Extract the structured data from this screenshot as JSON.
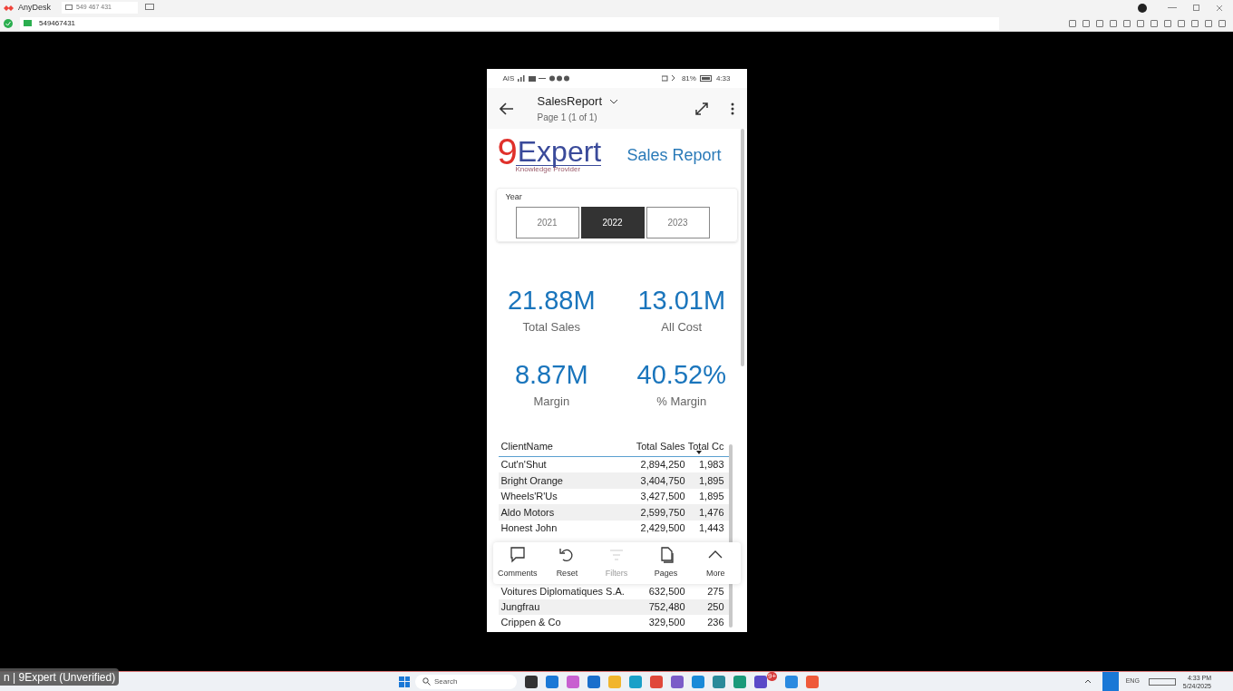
{
  "app": {
    "name": "AnyDesk",
    "tab_label": "549 467 431",
    "address": "549467431"
  },
  "phone": {
    "status_bar": {
      "carrier": "AIS",
      "battery": "81%",
      "time": "4:33"
    },
    "header": {
      "title": "SalesReport",
      "subtitle": "Page 1 (1 of 1)"
    },
    "logo": {
      "digit": "9",
      "word": "Expert",
      "tagline": "Knowledge Provider"
    },
    "report_title": "Sales Report",
    "slicer": {
      "label": "Year",
      "options": [
        {
          "label": "2021",
          "selected": false
        },
        {
          "label": "2022",
          "selected": true
        },
        {
          "label": "2023",
          "selected": false
        }
      ]
    },
    "kpis": [
      {
        "value": "21.88M",
        "label": "Total Sales"
      },
      {
        "value": "13.01M",
        "label": "All Cost"
      },
      {
        "value": "8.87M",
        "label": "Margin"
      },
      {
        "value": "40.52%",
        "label": "% Margin"
      }
    ],
    "table": {
      "columns": [
        {
          "label": "ClientName",
          "sorted": false
        },
        {
          "label": "Total Sales",
          "sorted": false
        },
        {
          "label": "Total Cc",
          "sorted": true
        }
      ],
      "rows": [
        [
          "Cut'n'Shut",
          "2,894,250",
          "1,983"
        ],
        [
          "Bright Orange",
          "3,404,750",
          "1,895"
        ],
        [
          "Wheels'R'Us",
          "3,427,500",
          "1,895"
        ],
        [
          "Aldo Motors",
          "2,599,750",
          "1,476"
        ],
        [
          "Honest John",
          "2,429,500",
          "1,443"
        ],
        null,
        null,
        null,
        [
          "Voitures Diplomatiques S.A.",
          "632,500",
          "275"
        ],
        [
          "Jungfrau",
          "752,480",
          "250"
        ],
        [
          "Crippen & Co",
          "329,500",
          "236"
        ]
      ]
    },
    "toolbar": [
      {
        "kind": "comments",
        "label": "Comments",
        "disabled": false
      },
      {
        "kind": "reset",
        "label": "Reset",
        "disabled": false
      },
      {
        "kind": "filters",
        "label": "Filters",
        "disabled": true
      },
      {
        "kind": "pages",
        "label": "Pages",
        "disabled": false
      },
      {
        "kind": "more",
        "label": "More",
        "disabled": false
      }
    ]
  },
  "tooltip": "n | 9Expert (Unverified)",
  "taskbar": {
    "search_placeholder": "Search",
    "badge": "9+",
    "language": "ENG",
    "time": "4:33 PM",
    "date": "5/24/2025"
  }
}
